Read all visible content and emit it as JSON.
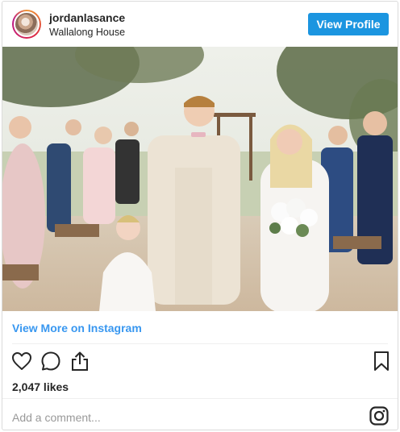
{
  "post": {
    "username": "jordanlasance",
    "location": "Wallalong House",
    "view_profile_label": "View Profile",
    "view_more_label": "View More on Instagram",
    "likes": "2,047 likes",
    "comment_placeholder": "Add a comment..."
  },
  "icons": {
    "like": "heart-icon",
    "comment": "comment-bubble-icon",
    "share": "share-icon",
    "save": "bookmark-icon",
    "logo": "instagram-logo-icon"
  },
  "colors": {
    "brand_blue": "#1b95e0",
    "link_blue": "#3897f0",
    "text": "#262626",
    "border": "#dbdbdb"
  }
}
